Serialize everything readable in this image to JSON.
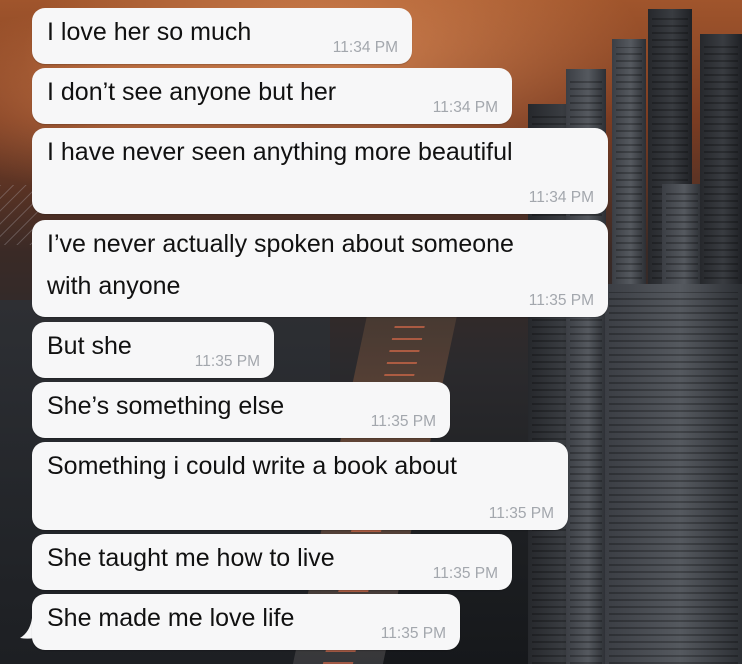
{
  "messages": [
    {
      "text": "I love her so much",
      "time": "11:34 PM"
    },
    {
      "text": "I don’t see anyone but her",
      "time": "11:34 PM"
    },
    {
      "text": "I have never seen anything more beautiful",
      "time": "11:34 PM"
    },
    {
      "text": "I’ve never actually spoken about someone\nwith anyone",
      "time": "11:35 PM"
    },
    {
      "text": "But she",
      "time": "11:35 PM"
    },
    {
      "text": "She’s something else",
      "time": "11:35 PM"
    },
    {
      "text": "Something i could write a book about",
      "time": "11:35 PM"
    },
    {
      "text": "She taught me how to live",
      "time": "11:35 PM"
    },
    {
      "text": "She made me love life",
      "time": "11:35 PM"
    }
  ],
  "colors": {
    "bubble": "#f7f7f8",
    "message_text": "#111111",
    "timestamp": "#a3a7ad"
  }
}
